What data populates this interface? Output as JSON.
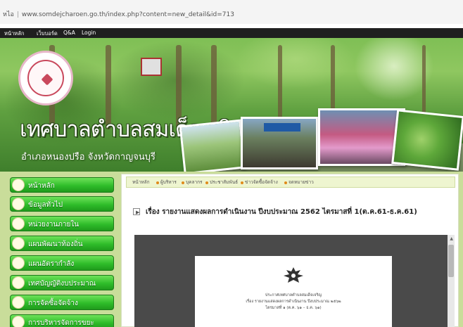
{
  "browser": {
    "address_prefix": "หไอ",
    "url": "www.somdejcharoen.go.th/index.php?content=new_detail&id=713"
  },
  "topnav": {
    "items": [
      "หน้าหลัก",
      "เว็บบอร์ด",
      "Q&A",
      "Login"
    ]
  },
  "banner": {
    "title": "เทศบาลตำบลสมเด็จเจริญ",
    "subtitle": "อำเภอหนองปรือ  จังหวัดกาญจนบุรี"
  },
  "sidebar": {
    "items": [
      {
        "label": "หน้าหลัก"
      },
      {
        "label": "ข้อมูลทั่วไป"
      },
      {
        "label": "หน่วยงานภายใน"
      },
      {
        "label": "แผนพัฒนาท้องถิ่น"
      },
      {
        "label": "แผนอัตรากำลัง"
      },
      {
        "label": "เทศบัญญัติงบประมาณ"
      },
      {
        "label": "การจัดซื้อจัดจ้าง"
      },
      {
        "label": "การบริหารจัดการขยะ"
      }
    ]
  },
  "breadcrumb": {
    "items": [
      "หน้าหลัก",
      "ผู้บริหาร",
      "บุคลากร",
      "ประชาสัมพันธ์",
      "ข่าวจัดซื้อจัดจ้าง",
      "จดหมายข่าว"
    ]
  },
  "article": {
    "heading": "เรื่อง รายงานแสดงผลการดำเนินงาน ปีงบประมาณ 2562 ไตรมาสที่ 1(ต.ค.61-ธ.ค.61)"
  },
  "document": {
    "lines": [
      "ประกาศเทศบาลตำบลสมเด็จเจริญ",
      "เรื่อง รายงานแสดงผลการดำเนินงาน ปีงบประมาณ ๒๕๖๒",
      "ไตรมาสที่ ๑ (ต.ค. ๖๑ – ธ.ค. ๖๑)"
    ]
  }
}
